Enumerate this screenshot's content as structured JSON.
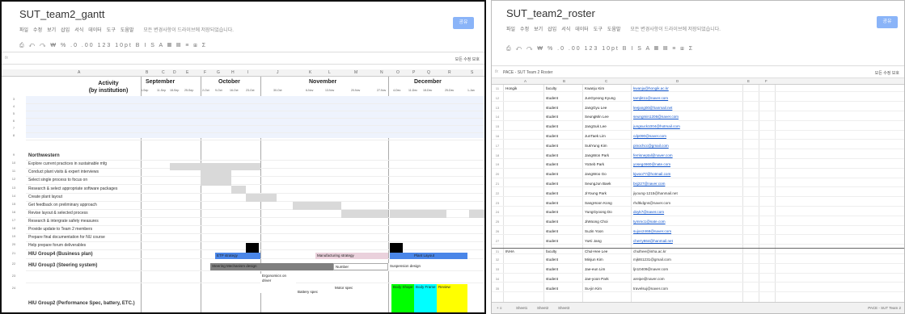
{
  "gantt": {
    "title": "SUT_team2_gantt",
    "menu": [
      "파일",
      "수정",
      "보기",
      "삽입",
      "서식",
      "데이터",
      "도구",
      "도움말"
    ],
    "menu_note": "모든 변경사항이 드라이브에 저장되었습니다.",
    "share_label": "공유",
    "toolbar_text": "⎙ ↶ ↷  ₩  % .0 .00 123  10pt  B I S A  ▦ ▤ ≡ ⊞ Σ",
    "formula_ref": "",
    "sheet_label": "모든 수정 보호",
    "columns": [
      "A",
      "B",
      "C",
      "D",
      "E",
      "F",
      "G",
      "H",
      "I",
      "J",
      "K",
      "L",
      "M",
      "N",
      "O",
      "P",
      "Q",
      "R",
      "S"
    ],
    "activity_header_1": "Activity",
    "activity_header_2": "(by institution)",
    "months": [
      "September",
      "October",
      "November",
      "December"
    ],
    "weeks": [
      "4-Sep",
      "11-Sep",
      "18-Sep",
      "25-Sep",
      "2-Oct",
      "9-Oct",
      "16-Oct",
      "23-Oct",
      "30-Oct",
      "6-Nov",
      "13-Nov",
      "20-Nov",
      "27-Nov",
      "4-Dec",
      "11-Dec",
      "18-Dec",
      "25-Dec",
      "1-Jan"
    ],
    "row_numbers": [
      "3",
      "4",
      "5",
      "6",
      "7",
      "8",
      "9",
      "10",
      "11",
      "12",
      "13",
      "14",
      "15",
      "16",
      "17",
      "18",
      "19",
      "20",
      "21",
      "22",
      "23",
      "24"
    ],
    "section": "Northwestern",
    "activities": [
      "Explore current practices in sustainable mfg",
      "Conduct plant visits & expert interviews",
      "Select single process to focus on",
      "Research & select appropriate software packages",
      "Create plant layout",
      "Get feedback on preliminary approach",
      "Revise layout & selected process",
      "Research & intergrate safety measures",
      "Provide update to Team 2 members",
      "Prepare final documentation for NU course",
      "Help prepare forum deliverables"
    ],
    "groups": [
      "HIU Group4 (Business plan)",
      "HIU Group3 (Steering system)",
      "HIU Group2 (Performance Spec, battery, ETC.)"
    ],
    "bar_labels": {
      "etp": "ETP strategy",
      "mfg": "Manufacturing strategy",
      "layout": "Plant Layout",
      "steering": "Steering Mechanism design",
      "number": "Number",
      "suspension": "Suspension design",
      "ergonomics": "Ergonomics on driver",
      "battery": "Battery spec",
      "motor": "Motor spec",
      "body": "Body Shape",
      "frame": "Body Frame",
      "review": "Review"
    },
    "colors": {
      "gray": "#d9d9d9",
      "black": "#000000",
      "blue": "#4a86e8",
      "pink": "#ead1dc",
      "dark": "#7f7f7f",
      "cyan": "#00ffff",
      "yellow": "#ffff00",
      "green": "#00ff00"
    }
  },
  "roster": {
    "title": "SUT_team2_roster",
    "menu": [
      "파일",
      "수정",
      "보기",
      "삽입",
      "서식",
      "데이터",
      "도구",
      "도움말"
    ],
    "menu_note": "모든 변경사항이 드라이브에 저장되었습니다.",
    "share_label": "공유",
    "toolbar_text": "⎙ ↶ ↷  ₩  % .0 .00 123  10pt  B I S A  ▦ ▤ ≡ ⊞ Σ",
    "formula_ref": "PACE - SUT Team 2 Roster",
    "sheet_label": "모든 수정 보호",
    "columns": [
      "A",
      "B",
      "C",
      "D",
      "E",
      "F"
    ],
    "rows": [
      {
        "n": "11",
        "inst": "Hongik",
        "role": "faculty",
        "name": "Kwanju Kim",
        "email": "kwanju@hongik.ac.kr",
        "link": true
      },
      {
        "n": "12",
        "inst": "",
        "role": "student",
        "name": "JunGyeong Kyung",
        "email": "tarnjkt11@naver.com",
        "link": true
      },
      {
        "n": "13",
        "inst": "",
        "role": "student",
        "name": "JangGyu Lee",
        "email": "leejang00@hanmail.net",
        "link": true
      },
      {
        "n": "14",
        "inst": "",
        "role": "student",
        "name": "SeungMin Lee",
        "email": "seungmin1206@naver.com",
        "link": true
      },
      {
        "n": "15",
        "inst": "",
        "role": "student",
        "name": "JangSuk Lee",
        "email": "jungsuck1004@hotmail.com",
        "link": true
      },
      {
        "n": "16",
        "inst": "",
        "role": "student",
        "name": "JunTaek Lim",
        "email": "cdp090@naver.com",
        "link": true
      },
      {
        "n": "17",
        "inst": "",
        "role": "student",
        "name": "SukYung Kim",
        "email": "pinochcc@gmail.com",
        "link": true
      },
      {
        "n": "18",
        "inst": "",
        "role": "student",
        "name": "JangWon Park",
        "email": "ferrisneptal@naver.com",
        "link": true
      },
      {
        "n": "19",
        "inst": "",
        "role": "student",
        "name": "YoSeb Park",
        "email": "yoseg4660@nate.com",
        "link": true
      },
      {
        "n": "20",
        "inst": "",
        "role": "student",
        "name": "JangWoo Go",
        "email": "kjwoo77@hotmail.com",
        "link": true
      },
      {
        "n": "21",
        "inst": "",
        "role": "student",
        "name": "SeungJun Baek",
        "email": "bsj227@naver.com",
        "link": true
      },
      {
        "n": "22",
        "inst": "",
        "role": "student",
        "name": "JiYoung Park",
        "email": "jiyoung-1215@hanmail.net",
        "link": false
      },
      {
        "n": "23",
        "inst": "",
        "role": "student",
        "name": "SangHoon Kong",
        "email": "rhdtkdgns@naver.com",
        "link": false
      },
      {
        "n": "24",
        "inst": "",
        "role": "student",
        "name": "YungGyoong Do",
        "email": "doyk7@naver.com",
        "link": true
      },
      {
        "n": "25",
        "inst": "",
        "role": "student",
        "name": "JiWoong Choi",
        "email": "tymmc1@nate.com",
        "link": true
      },
      {
        "n": "26",
        "inst": "",
        "role": "student",
        "name": "SuJin Yoon",
        "email": "sujoo2468@naver.com",
        "link": true
      },
      {
        "n": "27",
        "inst": "",
        "role": "student",
        "name": "YuKi Jang",
        "email": "cherry864@hanmail.net",
        "link": true
      },
      {
        "n": "31",
        "inst": "INHA",
        "role": "faculty",
        "name": "Chul-Hee Lee",
        "email": "chulhee@inha.ac.kr",
        "link": false
      },
      {
        "n": "32",
        "inst": "",
        "role": "student",
        "name": "Minjun Kim",
        "email": "mjkt61231@gmail.com",
        "link": false
      },
      {
        "n": "33",
        "inst": "",
        "role": "student",
        "name": "Jae-eun Lim",
        "email": "ljn10409@naver.com",
        "link": false
      },
      {
        "n": "34",
        "inst": "",
        "role": "student",
        "name": "Jae-yoon Park",
        "email": "areipe@naver.com",
        "link": false
      },
      {
        "n": "35",
        "inst": "",
        "role": "student",
        "name": "Su-jin Kim",
        "email": "travelsuj@naver.com",
        "link": false
      }
    ],
    "tabs": [
      "Sheet1",
      "Sheet2",
      "Sheet3"
    ],
    "tab_right": "PACE - SUT Team 2"
  }
}
